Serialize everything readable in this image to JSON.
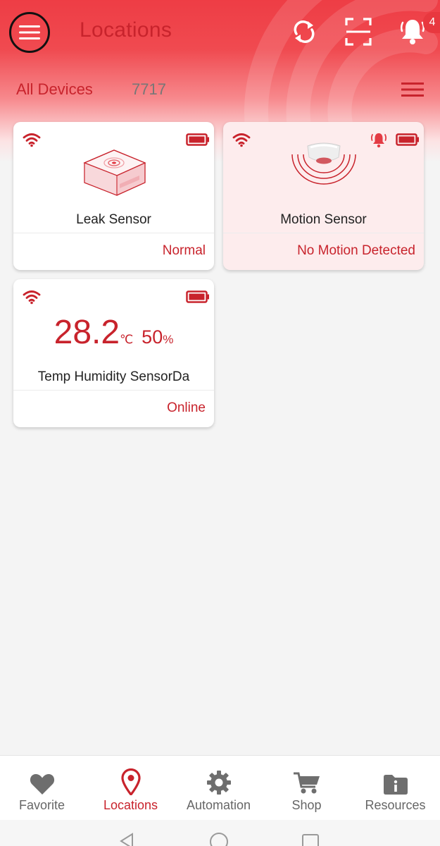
{
  "header": {
    "title": "Locations",
    "notification_count": "4",
    "icons": [
      "menu-icon",
      "sync-icon",
      "scan-icon",
      "bell-icon"
    ]
  },
  "subbar": {
    "label": "All Devices",
    "count": "7717",
    "icon": "list-icon"
  },
  "devices": [
    {
      "name": "Leak Sensor",
      "status": "Normal",
      "icons": [
        "wifi-icon",
        "battery-icon"
      ],
      "alert": false
    },
    {
      "name": "Motion Sensor",
      "status": "No Motion Detected",
      "icons": [
        "wifi-icon",
        "alarm-bell-icon",
        "battery-icon"
      ],
      "alert": true
    },
    {
      "name": "Temp Humidity SensorDa",
      "status": "Online",
      "temperature": "28.2",
      "temp_unit": "℃",
      "humidity": "50",
      "humidity_unit": "%",
      "icons": [
        "wifi-icon",
        "battery-icon"
      ],
      "alert": false
    }
  ],
  "bottom_nav": [
    {
      "label": "Favorite",
      "icon": "heart-icon",
      "active": false
    },
    {
      "label": "Locations",
      "icon": "location-pin-icon",
      "active": true
    },
    {
      "label": "Automation",
      "icon": "gear-icon",
      "active": false
    },
    {
      "label": "Shop",
      "icon": "cart-icon",
      "active": false
    },
    {
      "label": "Resources",
      "icon": "folder-info-icon",
      "active": false
    }
  ],
  "colors": {
    "brand_red": "#c8232c",
    "header_red": "#ee3d45",
    "alert_card_bg": "#fdeced",
    "page_bg": "#f4f4f4"
  }
}
